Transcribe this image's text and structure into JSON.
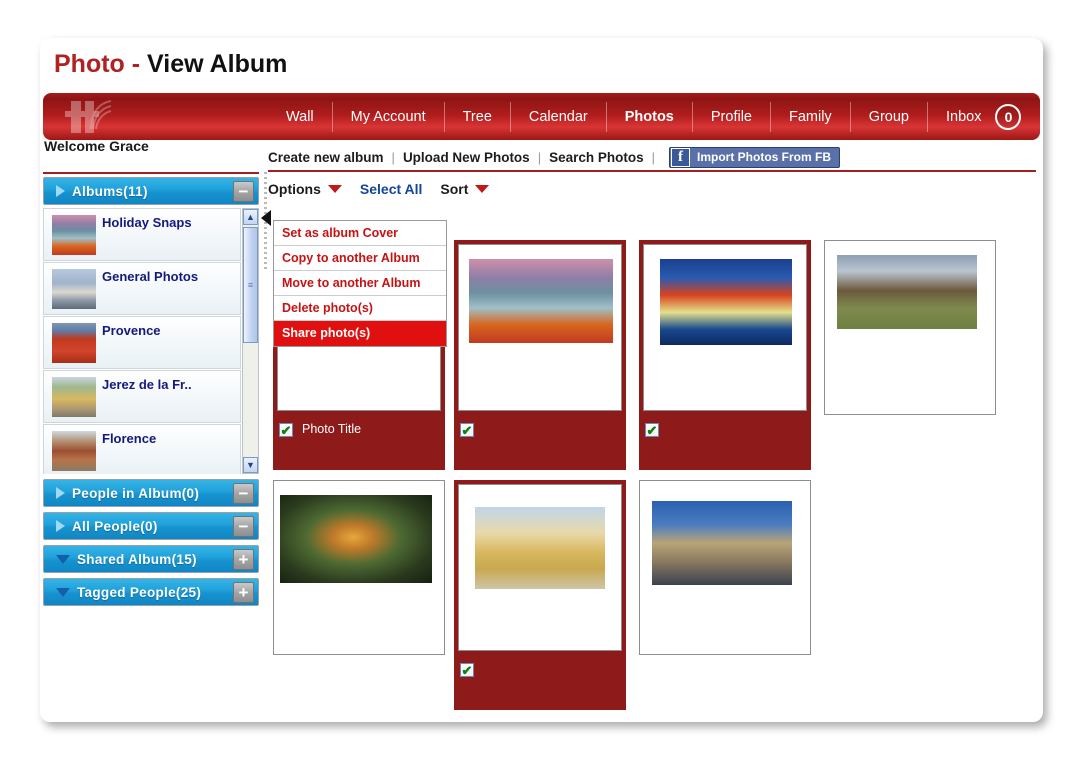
{
  "page": {
    "title_red": "Photo -",
    "title_black": "View Album",
    "welcome": "Welcome Grace"
  },
  "nav": {
    "items": [
      {
        "label": "Wall",
        "active": false
      },
      {
        "label": "My Account",
        "active": false
      },
      {
        "label": "Tree",
        "active": false
      },
      {
        "label": "Calendar",
        "active": false
      },
      {
        "label": "Photos",
        "active": true
      },
      {
        "label": "Profile",
        "active": false
      },
      {
        "label": "Family",
        "active": false
      },
      {
        "label": "Group",
        "active": false
      },
      {
        "label": "Inbox",
        "active": false
      }
    ],
    "badge_count": "0",
    "logo_name": "ff-monogram-logo"
  },
  "actions": {
    "links": [
      "Create new album",
      "Upload New Photos",
      "Search Photos"
    ],
    "separator": "|",
    "fb_button": {
      "glyph": "f",
      "label": "Import Photos From FB"
    }
  },
  "sidebar": {
    "panels": [
      {
        "label": "Albums(11)",
        "expanded": true,
        "toggle": "−"
      },
      {
        "label": "People in Album(0)",
        "expanded": true,
        "toggle": "−"
      },
      {
        "label": "All People(0)",
        "expanded": true,
        "toggle": "−"
      },
      {
        "label": "Shared Album(15)",
        "expanded": false,
        "toggle": "+"
      },
      {
        "label": "Tagged People(25)",
        "expanded": false,
        "toggle": "+"
      }
    ],
    "albums": [
      {
        "name": "Holiday Snaps",
        "thumb": "lake-canoes"
      },
      {
        "name": "General Photos",
        "thumb": "harbor-city"
      },
      {
        "name": "Provence",
        "thumb": "market-peppers"
      },
      {
        "name": "Jerez de la Fr..",
        "thumb": "street-plaza"
      },
      {
        "name": "Florence",
        "thumb": "duomo-dome"
      }
    ],
    "scrollbar": {
      "up": "▲",
      "down": "▼",
      "grip": "≡"
    }
  },
  "toolbar": {
    "options_label": "Options",
    "select_all_label": "Select All",
    "sort_label": "Sort"
  },
  "options_menu": {
    "items": [
      {
        "label": "Set as album Cover",
        "selected": false
      },
      {
        "label": "Copy to another Album",
        "selected": false
      },
      {
        "label": "Move to another Album",
        "selected": false
      },
      {
        "label": "Delete photo(s)",
        "selected": false
      },
      {
        "label": "Share photo(s)",
        "selected": true
      }
    ]
  },
  "photos": [
    {
      "id": "photo-1",
      "name": "abstract-swirl",
      "selected": true,
      "title": "Photo Title",
      "checked": true
    },
    {
      "id": "photo-2",
      "name": "lake-canoes",
      "selected": true,
      "title": "",
      "checked": true
    },
    {
      "id": "photo-3",
      "name": "golden-gate-bridge",
      "selected": true,
      "title": "",
      "checked": true
    },
    {
      "id": "photo-4",
      "name": "flying-eagle",
      "selected": false,
      "title": "",
      "checked": false
    },
    {
      "id": "photo-5",
      "name": "butterfly-flower",
      "selected": false,
      "title": "",
      "checked": false
    },
    {
      "id": "photo-6",
      "name": "brandenburg-gate",
      "selected": true,
      "title": "",
      "checked": true
    },
    {
      "id": "photo-7",
      "name": "guggenheim-bilbao",
      "selected": false,
      "title": "",
      "checked": false
    }
  ],
  "colors": {
    "brand_red": "#a32020",
    "nav_red": "#b01d1d",
    "selected_card": "#8f1a1a",
    "menu_highlight": "#e01010",
    "panel_blue": "#1fa0da",
    "album_name": "#13197e",
    "link_blue": "#12459b",
    "fb_blue": "#3b5998"
  },
  "checkmark_glyph": "✔"
}
